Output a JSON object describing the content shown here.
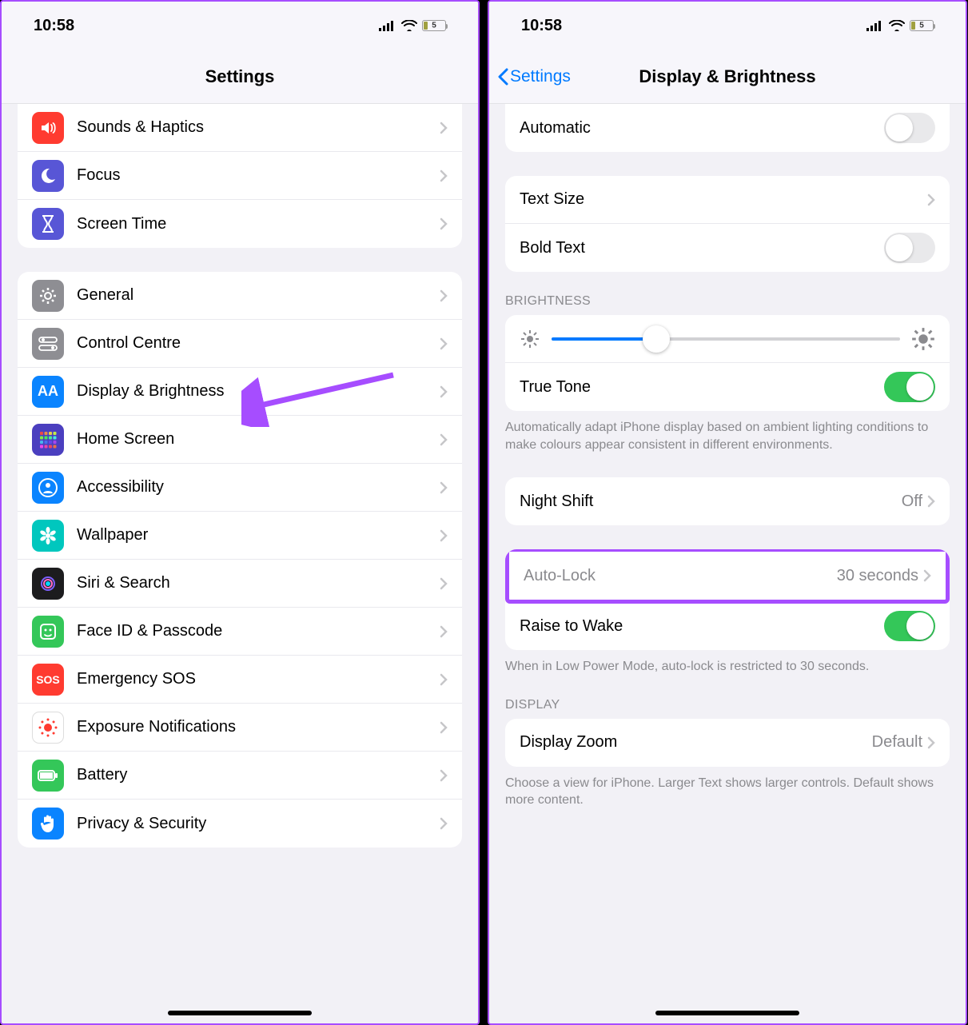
{
  "status": {
    "time": "10:58",
    "battery": "5",
    "battery_pct": 18
  },
  "left": {
    "title": "Settings",
    "group1": [
      {
        "key": "sounds",
        "label": "Sounds & Haptics",
        "bg": "#ff3b30",
        "icon": "speaker"
      },
      {
        "key": "focus",
        "label": "Focus",
        "bg": "#5856d6",
        "icon": "moon"
      },
      {
        "key": "screentime",
        "label": "Screen Time",
        "bg": "#5856d6",
        "icon": "hourglass"
      }
    ],
    "group2": [
      {
        "key": "general",
        "label": "General",
        "bg": "#8e8e93",
        "icon": "gear"
      },
      {
        "key": "controlcentre",
        "label": "Control Centre",
        "bg": "#8e8e93",
        "icon": "switches"
      },
      {
        "key": "display",
        "label": "Display & Brightness",
        "bg": "#0a84ff",
        "icon": "aa"
      },
      {
        "key": "homescreen",
        "label": "Home Screen",
        "bg": "#4b3fbf",
        "icon": "grid"
      },
      {
        "key": "accessibility",
        "label": "Accessibility",
        "bg": "#0a84ff",
        "icon": "person"
      },
      {
        "key": "wallpaper",
        "label": "Wallpaper",
        "bg": "#00c7be",
        "icon": "flower"
      },
      {
        "key": "siri",
        "label": "Siri & Search",
        "bg": "#1c1c1e",
        "icon": "siri"
      },
      {
        "key": "faceid",
        "label": "Face ID & Passcode",
        "bg": "#34c759",
        "icon": "face"
      },
      {
        "key": "sos",
        "label": "Emergency SOS",
        "bg": "#ff3b30",
        "icon": "sos"
      },
      {
        "key": "exposure",
        "label": "Exposure Notifications",
        "bg": "#ffffff",
        "icon": "exposure"
      },
      {
        "key": "battery",
        "label": "Battery",
        "bg": "#34c759",
        "icon": "battery"
      },
      {
        "key": "privacy",
        "label": "Privacy & Security",
        "bg": "#0a84ff",
        "icon": "hand"
      }
    ]
  },
  "right": {
    "back": "Settings",
    "title": "Display & Brightness",
    "automatic": {
      "label": "Automatic",
      "on": false
    },
    "textsize": {
      "label": "Text Size"
    },
    "boldtext": {
      "label": "Bold Text",
      "on": false
    },
    "brightness_header": "BRIGHTNESS",
    "brightness_pct": 30,
    "truetone": {
      "label": "True Tone",
      "on": true
    },
    "truetone_footer": "Automatically adapt iPhone display based on ambient lighting conditions to make colours appear consistent in different environments.",
    "nightshift": {
      "label": "Night Shift",
      "value": "Off"
    },
    "autolock": {
      "label": "Auto-Lock",
      "value": "30 seconds"
    },
    "raisetowake": {
      "label": "Raise to Wake",
      "on": true
    },
    "autolock_footer": "When in Low Power Mode, auto-lock is restricted to 30 seconds.",
    "display_header": "DISPLAY",
    "displayzoom": {
      "label": "Display Zoom",
      "value": "Default"
    },
    "displayzoom_footer": "Choose a view for iPhone. Larger Text shows larger controls. Default shows more content."
  }
}
